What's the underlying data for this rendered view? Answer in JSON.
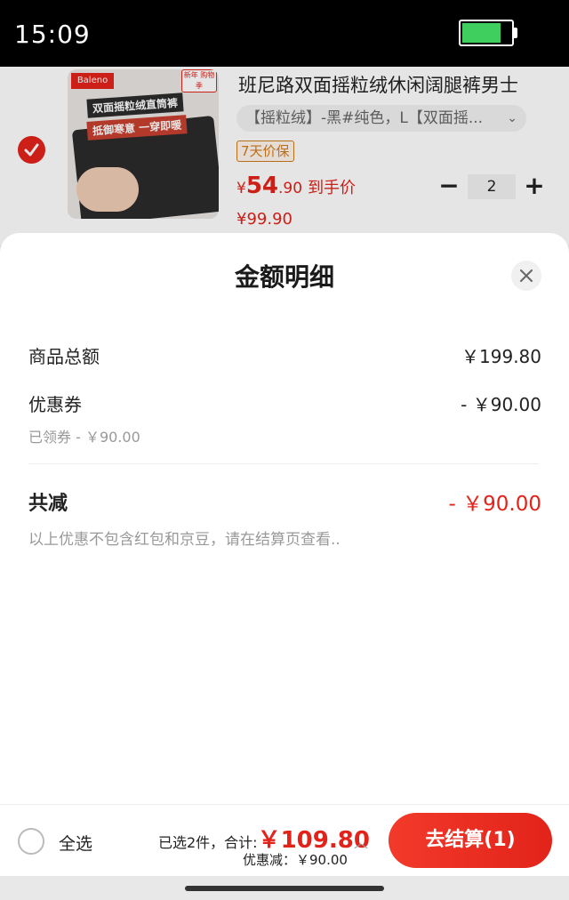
{
  "status_bar": {
    "time": "15:09",
    "battery_level": 0.8,
    "battery_color": "#3fcf5f"
  },
  "cart_item": {
    "selected": true,
    "image_logo": "Baleno",
    "image_badge": "新年 购物季",
    "image_banner_line1": "双面摇粒绒直筒裤",
    "image_banner_line2": "抵御寒意 一穿即暖",
    "title": "班尼路双面摇粒绒休闲阔腿裤男士",
    "spec": "【摇粒绒】-黑#纯色，L【双面摇...",
    "price_protect_tag": "7天价保",
    "arrival_price": {
      "currency": "¥",
      "integer": "54",
      "decimal": ".90",
      "label": "到手价"
    },
    "original_price": "¥99.90",
    "quantity": "2",
    "minus_label": "−",
    "plus_label": "+"
  },
  "sheet": {
    "title": "金额明细",
    "rows": [
      {
        "label": "商品总额",
        "value": "￥199.80"
      },
      {
        "label": "优惠券",
        "value": "- ￥90.00",
        "note": "已领券 - ￥90.00"
      }
    ],
    "total": {
      "label": "共减",
      "value": "- ￥90.00"
    },
    "disclaimer": "以上优惠不包含红包和京豆，请在结算页查看.."
  },
  "bottom_bar": {
    "select_all_label": "全选",
    "selected_summary": "已选2件，合计:",
    "total_amount": "￥109.80",
    "discount_summary": "优惠减：￥90.00",
    "checkout_label": "去结算(1)"
  },
  "colors": {
    "accent": "#e2231a",
    "price_protect": "#d07a1c"
  }
}
